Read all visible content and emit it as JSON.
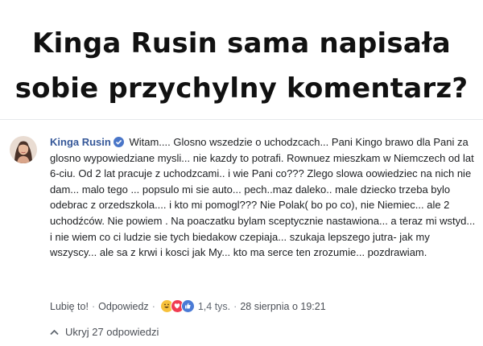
{
  "headline": {
    "line1": "Kinga Rusin sama napisała",
    "line2": "sobie przychylny komentarz?"
  },
  "comment": {
    "author": "Kinga Rusin",
    "text": " Witam.... Glosno wszedzie o uchodzcach... Pani Kingo brawo dla Pani za glosno wypowiedziane mysli... nie kazdy to potrafi. Rownuez mieszkam w Niemczech od lat 6-ciu. Od 2 lat pracuje z uchodzcami.. i wie Pani co??? Zlego slowa oowiedziec na nich nie dam... malo tego ... popsulo mi sie auto... pech..maz daleko.. male dziecko trzeba bylo odebrac z orzedszkola.... i kto mi pomogl??? Nie Polak( bo po co), nie Niemiec... ale 2 uchodźców. Nie powiem . Na poaczatku bylam sceptycznie nastawiona... a teraz mi wstyd... i nie wiem co ci ludzie sie tych biedakow czepiaja... szukaja lepszego jutra- jak my wszyscy... ale sa z krwi i kosci jak My... kto ma serce ten zrozumie... pozdrawiam.",
    "avatar_icon": "profile-photo",
    "verified_icon": "verified-badge-icon"
  },
  "actions": {
    "like": "Lubię to!",
    "separator": "·",
    "reply": "Odpowiedz",
    "reaction_count": "1,4 tys.",
    "date": "28 sierpnia o 19:21",
    "reaction_icons": [
      "haha-icon",
      "love-icon",
      "like-icon"
    ]
  },
  "replies": {
    "label": "Ukryj 27 odpowiedzi",
    "icon": "chevron-up-icon"
  },
  "colors": {
    "author": "#365899",
    "text": "#1c1e21",
    "meta": "#606770"
  }
}
